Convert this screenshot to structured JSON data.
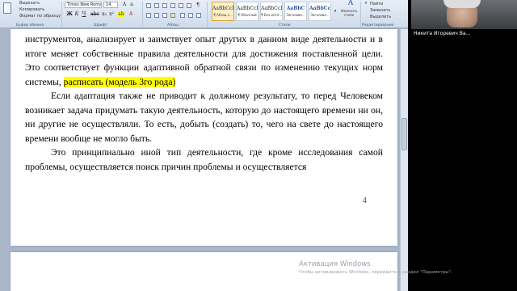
{
  "ribbon": {
    "clipboard": {
      "cut": "Вырезать",
      "copy": "Копировать",
      "format_painter": "Формат по образцу",
      "group": "Буфер обмена"
    },
    "font": {
      "name": "Times New Roman",
      "size": "14",
      "group": "Шрифт"
    },
    "paragraph": {
      "group": "Абзац"
    },
    "styles": {
      "items": [
        {
          "preview": "AaBbCcI",
          "name": "¶ Абзац с..."
        },
        {
          "preview": "AaBbCcD",
          "name": "¶ Обычный"
        },
        {
          "preview": "AaBbCcD",
          "name": "¶ Без инте..."
        },
        {
          "preview": "AaBbC",
          "name": "Заголово..."
        },
        {
          "preview": "AaBbCc",
          "name": "Заголово..."
        }
      ],
      "change_styles": "Изменить стили",
      "group": "Стили"
    },
    "editing": {
      "find": "Найти",
      "replace": "Заменить",
      "select": "Выделить",
      "group": "Редактирование"
    }
  },
  "document": {
    "para1": "инструментов, анализирует и заимствует опыт других в данном виде деятельности и в итоге меняет собственные правила деятельности для достижения поставленной цели. Это соответствует функции адаптивной обратной связи по изменению текущих норм системы,",
    "para1_highlight": "расписать (модель 3го рода)",
    "para2": "Если адаптация также не приводит к должному результату, то перед Человеком возникает задача придумать такую деятельность, которую до настоящего времени ни он, ни другие не осуществляли. То есть, добыть (создать)  то, чего на свете до настоящего времени вообще не могло быть.",
    "para3": "Это принципиально иной тип деятельности, где кроме исследования самой проблемы, осуществляется поиск причин проблемы и осуществляется",
    "page_number": "4"
  },
  "watermark": {
    "title": "Активация Windows",
    "subtitle": "Чтобы активировать Windows, перейдите в раздел \"Параметры\"."
  },
  "participant": {
    "name": "Никита Игоревич Ва..."
  }
}
